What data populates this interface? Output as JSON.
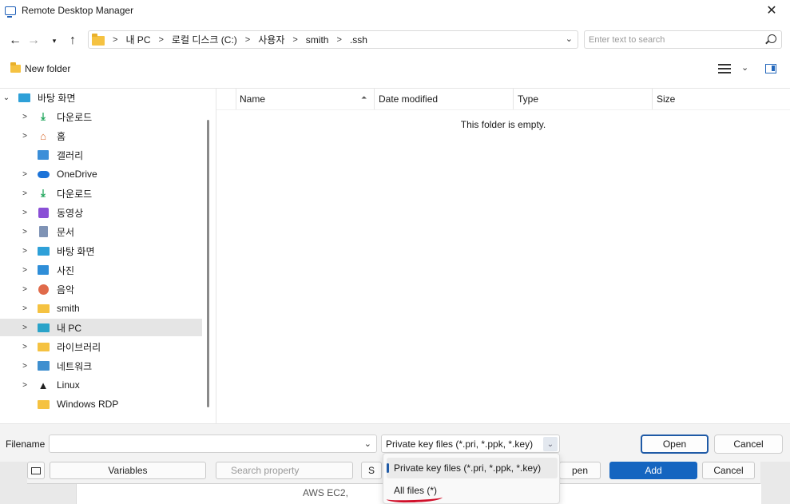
{
  "window": {
    "title": "Remote Desktop Manager"
  },
  "nav": {
    "path": [
      "내 PC",
      "로컬 디스크 (C:)",
      "사용자",
      "smith",
      ".ssh"
    ],
    "search_placeholder": "Enter text to search"
  },
  "commandbar": {
    "new_folder_label": "New folder"
  },
  "tree": {
    "items": [
      {
        "label": "바탕 화면",
        "icon": "desktop-icon",
        "expanded": true
      },
      {
        "label": "다운로드",
        "icon": "download-icon"
      },
      {
        "label": "홈",
        "icon": "home-icon"
      },
      {
        "label": "갤러리",
        "icon": "gallery-icon"
      },
      {
        "label": "OneDrive",
        "icon": "cloud-icon"
      },
      {
        "label": "다운로드",
        "icon": "download-icon"
      },
      {
        "label": "동영상",
        "icon": "video-icon"
      },
      {
        "label": "문서",
        "icon": "document-icon"
      },
      {
        "label": "바탕 화면",
        "icon": "desktop-icon"
      },
      {
        "label": "사진",
        "icon": "picture-icon"
      },
      {
        "label": "음악",
        "icon": "music-icon"
      },
      {
        "label": "smith",
        "icon": "folder-icon"
      },
      {
        "label": "내 PC",
        "icon": "pc-icon",
        "selected": true
      },
      {
        "label": "라이브러리",
        "icon": "folder-icon"
      },
      {
        "label": "네트워크",
        "icon": "network-icon"
      },
      {
        "label": "Linux",
        "icon": "linux-icon"
      },
      {
        "label": "Windows RDP",
        "icon": "folder-icon"
      }
    ]
  },
  "filelist": {
    "columns": [
      "Name",
      "Date modified",
      "Type",
      "Size"
    ],
    "empty_message": "This folder is empty."
  },
  "bottom": {
    "filename_label": "Filename",
    "filename_value": "",
    "filetype_selected": "Private key files (*.pri, *.ppk, *.key)",
    "open_label": "Open",
    "cancel_label": "Cancel"
  },
  "dropdown": {
    "options": [
      "Private key files (*.pri, *.ppk, *.key)",
      "All files (*)"
    ]
  },
  "background_dialog": {
    "variables_label": "Variables",
    "search_placeholder": "Search property",
    "s_label": "S",
    "open_label": "pen",
    "add_label": "Add",
    "cancel_label": "Cancel",
    "lower_text": "AWS EC2, "
  },
  "colors": {
    "accent": "#1f5aa6",
    "add_button": "#1565c0",
    "annotation": "#d0102a"
  }
}
